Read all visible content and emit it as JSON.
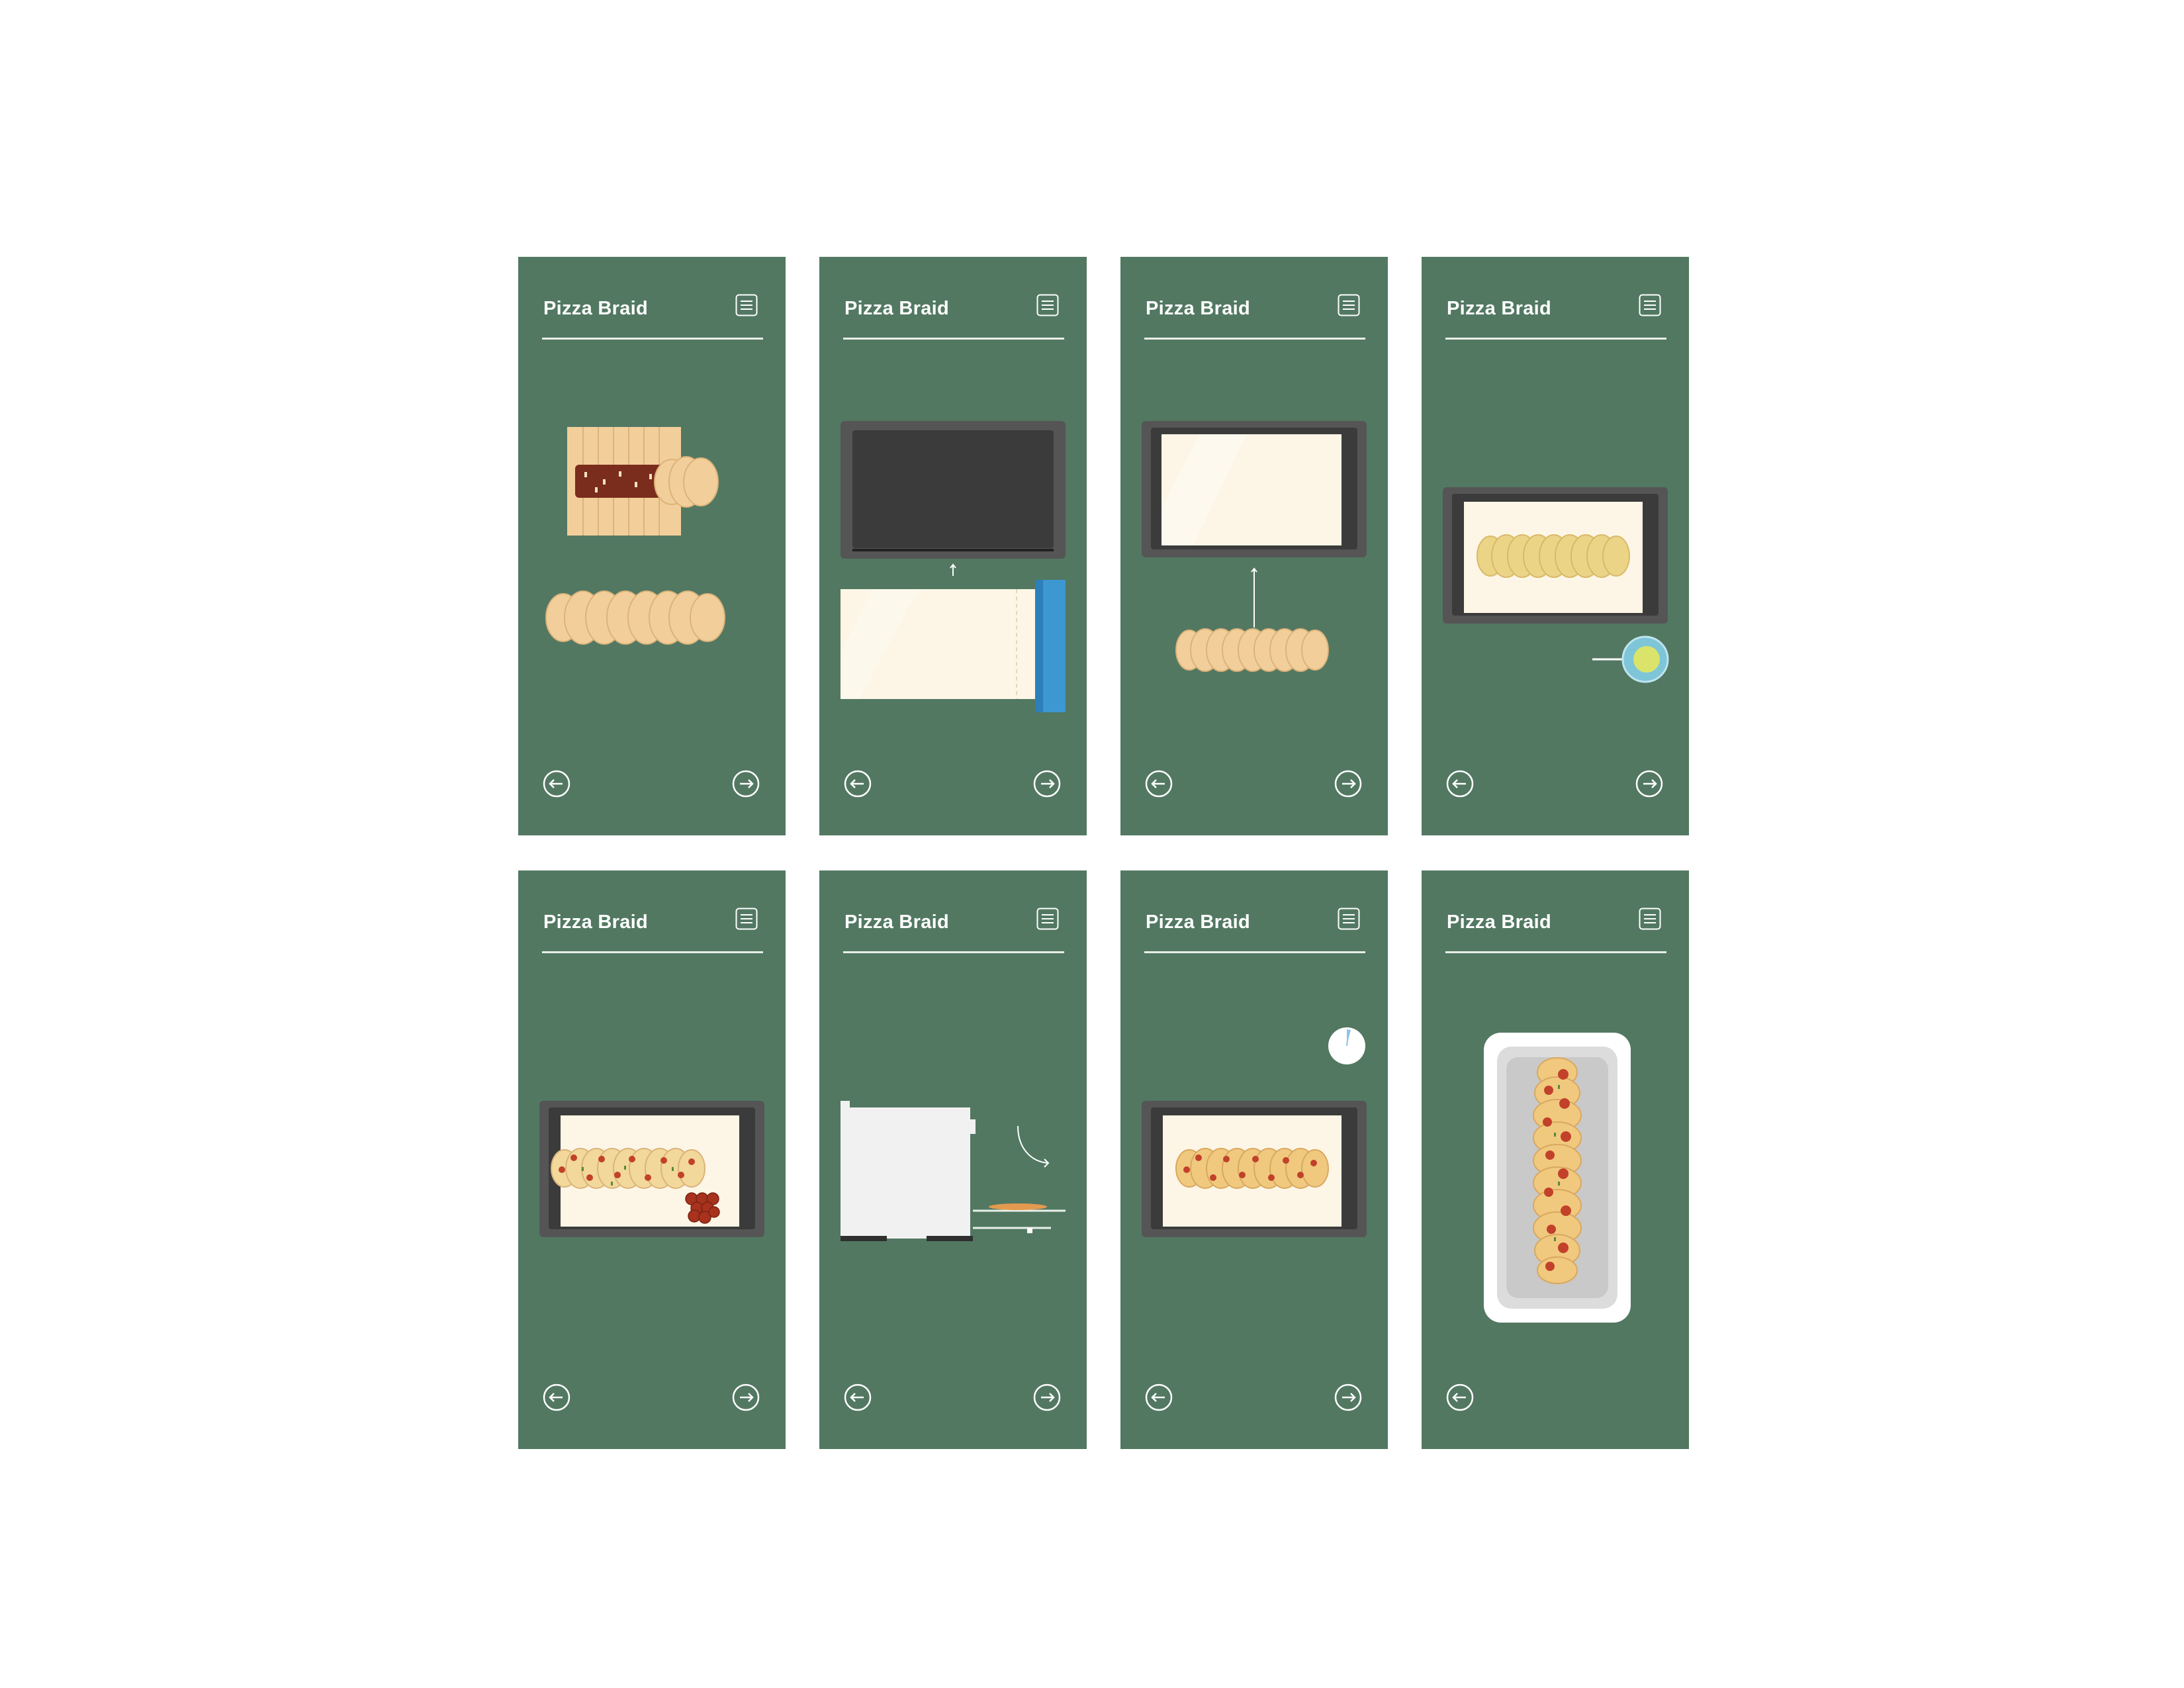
{
  "screens": [
    {
      "title": "Pizza Braid",
      "step": "braid-dough",
      "has_prev": true,
      "has_next": true
    },
    {
      "title": "Pizza Braid",
      "step": "line-pan-with-parchment",
      "has_prev": true,
      "has_next": true
    },
    {
      "title": "Pizza Braid",
      "step": "transfer-braid-to-pan",
      "has_prev": true,
      "has_next": true
    },
    {
      "title": "Pizza Braid",
      "step": "brush-with-egg-wash",
      "has_prev": true,
      "has_next": true
    },
    {
      "title": "Pizza Braid",
      "step": "add-toppings",
      "has_prev": true,
      "has_next": true
    },
    {
      "title": "Pizza Braid",
      "step": "bake-in-oven",
      "has_prev": true,
      "has_next": true
    },
    {
      "title": "Pizza Braid",
      "step": "cool-with-timer",
      "has_prev": true,
      "has_next": true
    },
    {
      "title": "Pizza Braid",
      "step": "serve",
      "has_prev": true,
      "has_next": false
    }
  ],
  "icons": {
    "menu": "menu-list-icon",
    "prev": "back-arrow-icon",
    "next": "forward-arrow-icon"
  },
  "colors": {
    "background": "#ffffff",
    "screen": "#527862",
    "dough": "#f2cf9a",
    "sauce": "#7a2d1c",
    "pan": "#3b3b3b",
    "parchment": "#fdf6e6",
    "foil_box": "#3d97d1",
    "pepperoni": "#c2412a"
  }
}
